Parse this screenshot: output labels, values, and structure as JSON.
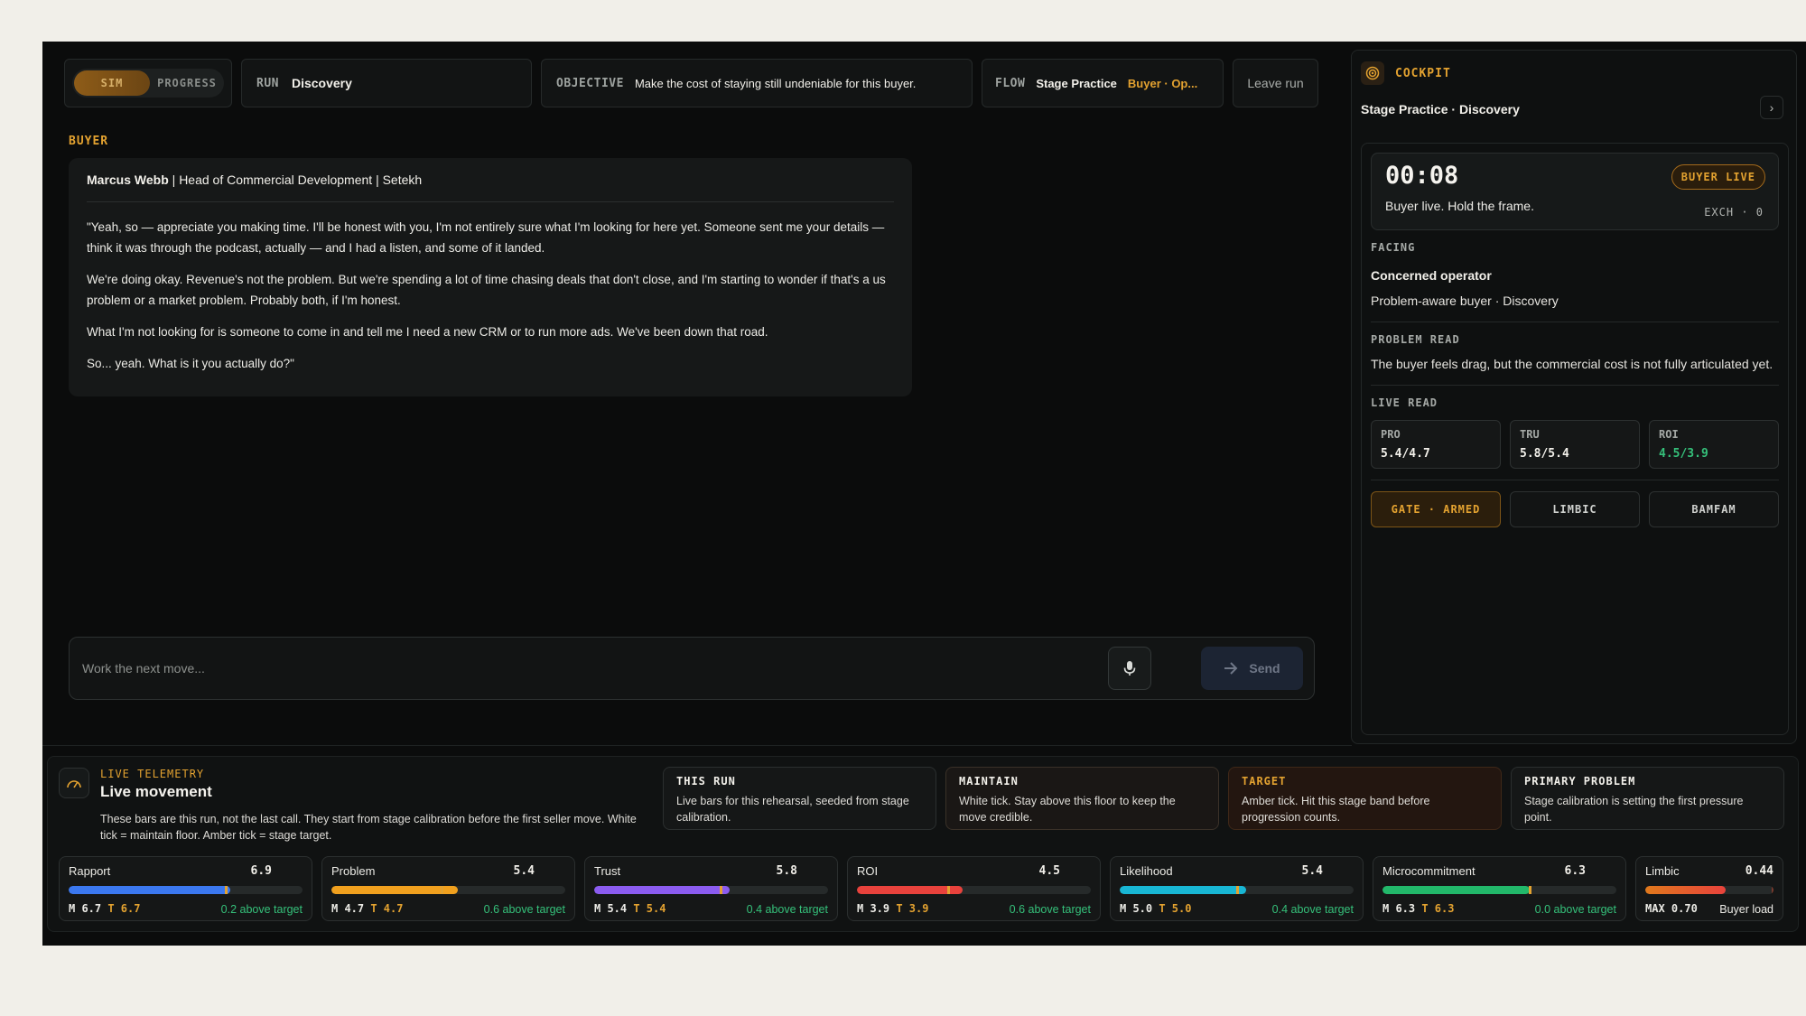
{
  "header": {
    "toggle": {
      "on": "SIM",
      "off": "PROGRESS"
    },
    "run": {
      "label": "RUN",
      "value": "Discovery"
    },
    "objective": {
      "label": "OBJECTIVE",
      "value": "Make the cost of staying still undeniable for this buyer."
    },
    "flow": {
      "label": "FLOW",
      "value": "Stage Practice",
      "sub": "Buyer · Op..."
    },
    "leave": "Leave run"
  },
  "buyer": {
    "section": "BUYER",
    "name": "Marcus Webb",
    "role": "Head of Commercial Development",
    "company": "Setekh",
    "paragraphs": [
      "\"Yeah, so — appreciate you making time. I'll be honest with you, I'm not entirely sure what I'm looking for here yet. Someone sent me your details — think it was through the podcast, actually — and I had a listen, and some of it landed.",
      "We're doing okay. Revenue's not the problem. But we're spending a lot of time chasing deals that don't close, and I'm starting to wonder if that's a us problem or a market problem. Probably both, if I'm honest.",
      "What I'm not looking for is someone to come in and tell me I need a new CRM or to run more ads. We've been down that road.",
      "So... yeah. What is it you actually do?\""
    ]
  },
  "composer": {
    "placeholder": "Work the next move...",
    "send": "Send"
  },
  "cockpit": {
    "title": "COCKPIT",
    "stage": "Stage Practice · Discovery",
    "timer": "00:08",
    "status": "Buyer live. Hold the frame.",
    "badge": "BUYER LIVE",
    "exchange": "EXCH · 0",
    "facing": {
      "label": "FACING",
      "title": "Concerned operator",
      "desc": "Problem-aware buyer · Discovery"
    },
    "problem": {
      "label": "PROBLEM READ",
      "desc": "The buyer feels drag, but the commercial cost is not fully articulated yet."
    },
    "live": {
      "label": "LIVE READ",
      "tiles": [
        {
          "k": "PRO",
          "v": "5.4/4.7",
          "color": "#f2f0ea"
        },
        {
          "k": "TRU",
          "v": "5.8/5.4",
          "color": "#f2f0ea"
        },
        {
          "k": "ROI",
          "v": "4.5/3.9",
          "color": "#35c07a"
        }
      ]
    },
    "buttons": [
      "GATE · ARMED",
      "LIMBIC",
      "BAMFAM"
    ]
  },
  "telemetry": {
    "label": "LIVE TELEMETRY",
    "title": "Live movement",
    "desc": "These bars are this run, not the last call. They start from stage calibration before the first seller move. White tick = maintain floor. Amber tick = stage target.",
    "cards": [
      {
        "label": "THIS RUN",
        "desc": "Live bars for this rehearsal, seeded from stage calibration."
      },
      {
        "label": "MAINTAIN",
        "desc": "White tick. Stay above this floor to keep the move credible."
      },
      {
        "label": "TARGET",
        "desc": "Amber tick. Hit this stage band before progression counts."
      },
      {
        "label": "PRIMARY PROBLEM",
        "desc": "Stage calibration is setting the first pressure point."
      }
    ],
    "metrics": [
      {
        "name": "Rapport",
        "score": "6.9",
        "m": "M 6.7",
        "t": "T 6.7",
        "note": "0.2 above target",
        "fill": 0.69,
        "tick": 0.67,
        "color": "#3b78f0"
      },
      {
        "name": "Problem",
        "score": "5.4",
        "m": "M 4.7",
        "t": "T 4.7",
        "note": "0.6 above target",
        "fill": 0.54,
        "tick": 0.47,
        "color": "#f0a01e"
      },
      {
        "name": "Trust",
        "score": "5.8",
        "m": "M 5.4",
        "t": "T 5.4",
        "note": "0.4 above target",
        "fill": 0.58,
        "tick": 0.54,
        "color": "#8b5cf0"
      },
      {
        "name": "ROI",
        "score": "4.5",
        "m": "M 3.9",
        "t": "T 3.9",
        "note": "0.6 above target",
        "fill": 0.45,
        "tick": 0.39,
        "color": "#e8423c"
      },
      {
        "name": "Likelihood",
        "score": "5.4",
        "m": "M 5.0",
        "t": "T 5.0",
        "note": "0.4 above target",
        "fill": 0.54,
        "tick": 0.5,
        "color": "#18b6d4"
      },
      {
        "name": "Microcommitment",
        "score": "6.3",
        "m": "M 6.3",
        "t": "T 6.3",
        "note": "0.0 above target",
        "fill": 0.63,
        "tick": 0.63,
        "color": "#22b86a"
      },
      {
        "name": "Limbic",
        "score": "0.44",
        "m": "MAX 0.70",
        "t": "",
        "note": "Buyer load",
        "fill": 0.63,
        "tick": 0.99,
        "color": "#e8603c"
      }
    ]
  }
}
